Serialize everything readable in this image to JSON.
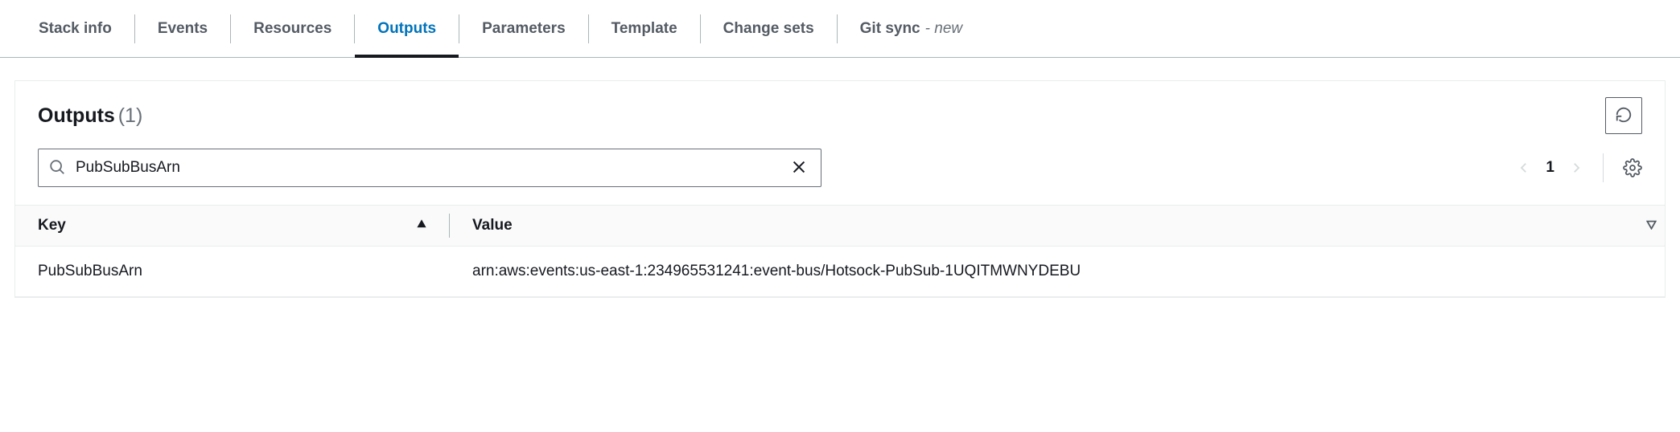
{
  "tabs": [
    {
      "label": "Stack info",
      "active": false
    },
    {
      "label": "Events",
      "active": false
    },
    {
      "label": "Resources",
      "active": false
    },
    {
      "label": "Outputs",
      "active": true
    },
    {
      "label": "Parameters",
      "active": false
    },
    {
      "label": "Template",
      "active": false
    },
    {
      "label": "Change sets",
      "active": false
    },
    {
      "label": "Git sync",
      "suffix": "- new",
      "active": false
    }
  ],
  "panel": {
    "title": "Outputs",
    "count": "(1)"
  },
  "search": {
    "value": "PubSubBusArn"
  },
  "pagination": {
    "page": "1"
  },
  "table": {
    "headers": {
      "key": "Key",
      "value": "Value"
    },
    "rows": [
      {
        "key": "PubSubBusArn",
        "value": "arn:aws:events:us-east-1:234965531241:event-bus/Hotsock-PubSub-1UQITMWNYDEBU"
      }
    ]
  }
}
